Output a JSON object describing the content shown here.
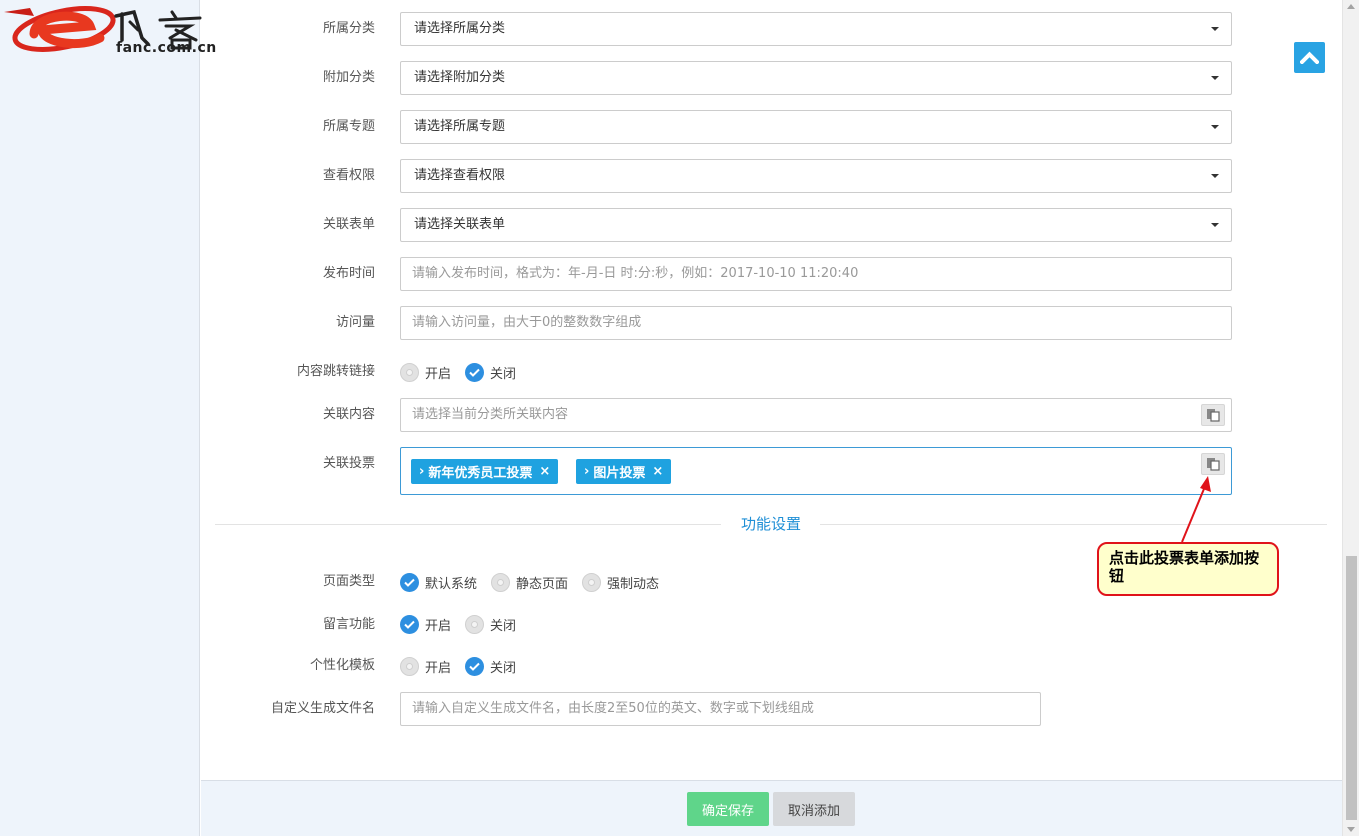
{
  "logo": {
    "text": "fanc.com.cn"
  },
  "form": {
    "category": {
      "label": "所属分类",
      "value": "请选择所属分类"
    },
    "extra_category": {
      "label": "附加分类",
      "value": "请选择附加分类"
    },
    "topic": {
      "label": "所属专题",
      "value": "请选择所属专题"
    },
    "permission": {
      "label": "查看权限",
      "value": "请选择查看权限"
    },
    "linked_form": {
      "label": "关联表单",
      "value": "请选择关联表单"
    },
    "publish_time": {
      "label": "发布时间",
      "placeholder": "请输入发布时间，格式为：年-月-日 时:分:秒，例如：2017-10-10 11:20:40"
    },
    "visits": {
      "label": "访问量",
      "placeholder": "请输入访问量，由大于0的整数数字组成"
    },
    "redirect": {
      "label": "内容跳转链接",
      "options": [
        {
          "label": "开启",
          "checked": false
        },
        {
          "label": "关闭",
          "checked": true
        }
      ]
    },
    "linked_content": {
      "label": "关联内容",
      "placeholder": "请选择当前分类所关联内容"
    },
    "linked_vote": {
      "label": "关联投票",
      "tags": [
        {
          "label": "新年优秀员工投票"
        },
        {
          "label": "图片投票"
        }
      ]
    }
  },
  "section": {
    "title": "功能设置"
  },
  "features": {
    "page_type": {
      "label": "页面类型",
      "options": [
        {
          "label": "默认系统",
          "checked": true
        },
        {
          "label": "静态页面",
          "checked": false
        },
        {
          "label": "强制动态",
          "checked": false
        }
      ]
    },
    "comments": {
      "label": "留言功能",
      "options": [
        {
          "label": "开启",
          "checked": true
        },
        {
          "label": "关闭",
          "checked": false
        }
      ]
    },
    "custom_template": {
      "label": "个性化模板",
      "options": [
        {
          "label": "开启",
          "checked": false
        },
        {
          "label": "关闭",
          "checked": true
        }
      ]
    },
    "filename": {
      "label": "自定义生成文件名",
      "placeholder": "请输入自定义生成文件名，由长度2至50位的英文、数字或下划线组成"
    }
  },
  "footer": {
    "save_label": "确定保存",
    "cancel_label": "取消添加"
  },
  "annotation": {
    "text": "点击此投票表单添加按钮"
  },
  "colors": {
    "accent": "#1fa2e0",
    "save": "#5fd58a",
    "callout_border": "#e0131a"
  }
}
